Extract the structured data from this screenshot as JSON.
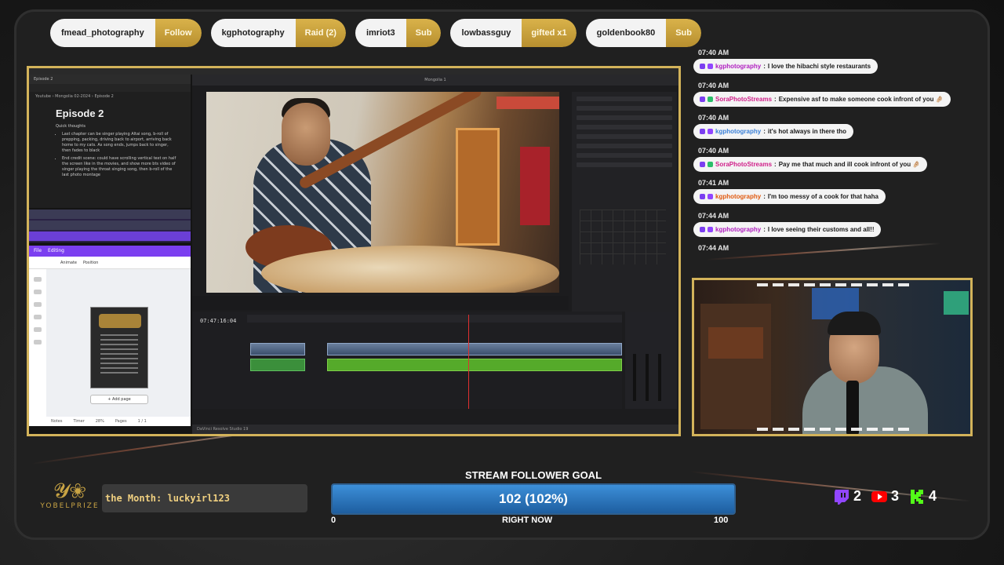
{
  "alerts": [
    {
      "user": "fmead_photography",
      "kind": "Follow"
    },
    {
      "user": "kgphotography",
      "kind": "Raid (2)"
    },
    {
      "user": "imriot3",
      "kind": "Sub"
    },
    {
      "user": "lowbassguy",
      "kind": "gifted x1"
    },
    {
      "user": "goldenbook80",
      "kind": "Sub"
    }
  ],
  "doc": {
    "title": "Episode 2",
    "tab": "Episode 2",
    "breadcrumb": "Youtube  ›  Mongolia 02-2024  ›  Episode 2",
    "intro": "Quick thoughts",
    "bullets": [
      "Last chapter can be singer playing Altai song, b-roll of prepping, packing, driving back to airport, arriving back home to my cats. As song ends, jumps back to singer, then fades to black",
      "End credit scene: could have scrolling vertical text on half the screen like in the movies, and show more bts video of singer playing the throat singing song, then b-roll of the last photo montage"
    ]
  },
  "canva": {
    "menu": [
      "File",
      "Editing"
    ],
    "tools": [
      "Animate",
      "Position"
    ],
    "add_page": "+ Add page",
    "footer": [
      "Notes",
      "Timer",
      "28%",
      "Pages",
      "1 / 1"
    ]
  },
  "resolve": {
    "project": "Mongolia 1",
    "timecode": "07:47:16:04",
    "footer": "DaVinci Resolve Studio 19"
  },
  "chat": [
    {
      "time": "07:40 AM",
      "user": "kgphotography",
      "user_color": "#b020c0",
      "message": "I love the hibachi style restaurants"
    },
    {
      "time": "07:40 AM",
      "user": "SoraPhotoStreams",
      "user_color": "#d0208a",
      "message": "Expensive asf to make someone cook infront of you 🤌🏼"
    },
    {
      "time": "07:40 AM",
      "user": "kgphotography",
      "user_color": "#3a80d8",
      "message": "it's hot always in there tho"
    },
    {
      "time": "07:40 AM",
      "user": "SoraPhotoStreams",
      "user_color": "#d0208a",
      "message": "Pay me that much and ill cook infront of you 🤌🏼"
    },
    {
      "time": "07:41 AM",
      "user": "kgphotography",
      "user_color": "#e05a10",
      "message": "I'm too messy of a cook for that haha"
    },
    {
      "time": "07:44 AM",
      "user": "kgphotography",
      "user_color": "#b020c0",
      "message": "I love seeing their customs and all!!"
    },
    {
      "time": "07:44 AM",
      "user": "",
      "user_color": "#ffffff",
      "message": ""
    }
  ],
  "month_banner": "the Month: luckyirl123",
  "logo_text": "YOBELPRIZE",
  "goal": {
    "title": "STREAM FOLLOWER GOAL",
    "value_label": "102 (102%)",
    "current": 102,
    "target": 100,
    "fill_fraction": 1.0,
    "min_label": "0",
    "max_label": "100",
    "now_label": "RIGHT NOW"
  },
  "platform_counts": [
    {
      "icon": "twitch-icon",
      "count": "2",
      "color": "#9146ff"
    },
    {
      "icon": "youtube-icon",
      "count": "3",
      "color": "#ff0000"
    },
    {
      "icon": "kick-icon",
      "count": "4",
      "color": "#53fc18"
    }
  ]
}
